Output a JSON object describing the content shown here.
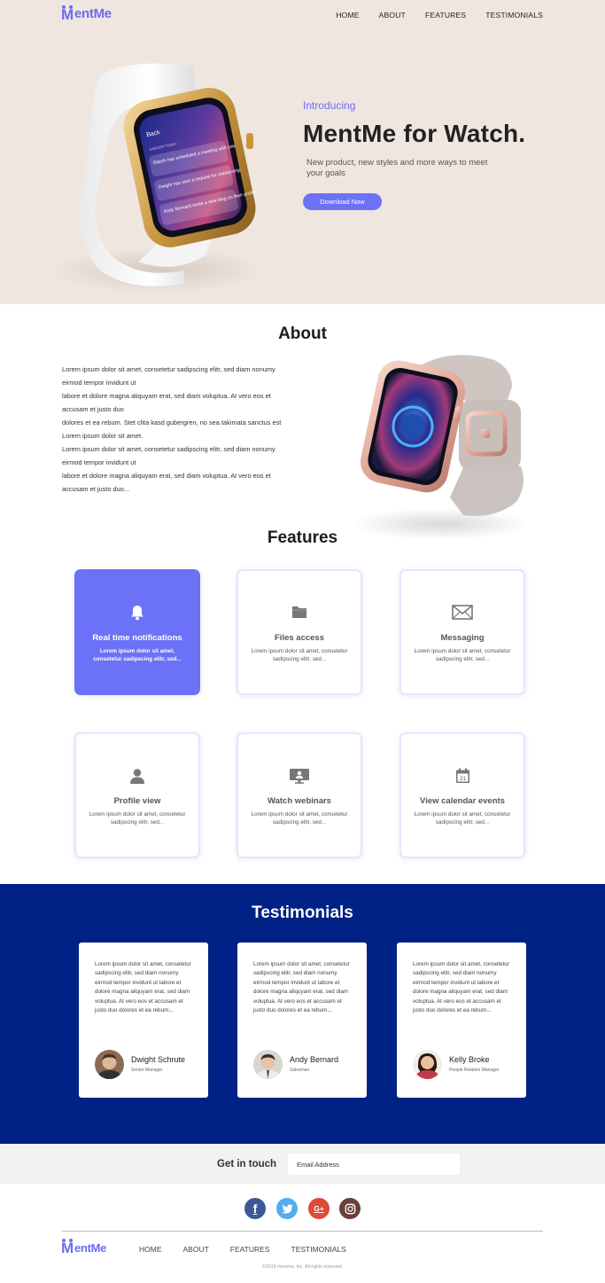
{
  "brand": {
    "name": "MentMe",
    "color": "#6b6bf0"
  },
  "nav": {
    "home": "HOME",
    "about": "ABOUT",
    "features": "FEATURES",
    "testimonials": "TESTIMONIALS"
  },
  "hero": {
    "intro": "Introducing",
    "title": "MentMe for Watch.",
    "subtitle": "New product, new styles and more ways to meet your goals",
    "download": "Download Now",
    "watch_screen": {
      "back": "Back",
      "header": "EARLIER TODAY",
      "items": [
        "Ritesh has scheduled a meeting with you",
        "Dwight has sent a request for mentorship",
        "Andy Bernard wrote a new blog on their profile"
      ]
    }
  },
  "about": {
    "title": "About",
    "lines": [
      "Lorem ipsum dolor sit amet, consetetur sadipscing  elitr, sed diam nonumy eirmod tempor invidunt ut",
      "labore et dolore magna aliquyam erat, sed diam  voluptua. At vero eos et accusam et justo duo",
      "dolores et ea rebum. Stet clita kasd gubergren, no  sea takimata sanctus est Lorem ipsum dolor sit amet.",
      "Lorem ipsum dolor sit amet, consetetur sadipscing  elitr, sed diam nonumy eirmod tempor invidunt ut",
      "labore et dolore magna aliquyam erat, sed diam  voluptua. At vero eos et accusam et justo duo..."
    ]
  },
  "features": {
    "title": "Features",
    "items": [
      {
        "icon": "bell-icon",
        "title": "Real time notifications",
        "desc": "Lorem ipsum dolor sit amet, consetetur sadipscing elitr, sed..."
      },
      {
        "icon": "folder-icon",
        "title": "Files access",
        "desc": "Lorem ipsum dolor sit amet, consetetur sadipscing elitr, sed..."
      },
      {
        "icon": "envelope-icon",
        "title": "Messaging",
        "desc": "Lorem ipsum dolor sit amet, consetetur sadipscing elitr, sed..."
      },
      {
        "icon": "user-icon",
        "title": "Profile view",
        "desc": "Lorem ipsum dolor sit amet, consetetur sadipscing elitr, sed..."
      },
      {
        "icon": "presentation-icon",
        "title": "Watch webinars",
        "desc": "Lorem ipsum dolor sit amet, consetetur sadipscing elitr, sed..."
      },
      {
        "icon": "calendar-icon",
        "title": "View calendar events",
        "desc": "Lorem ipsum dolor sit amet, consetetur sadipscing elitr, sed...",
        "calendar_day": "21"
      }
    ]
  },
  "testimonials": {
    "title": "Testimonials",
    "items": [
      {
        "quote": "Lorem ipsum dolor sit amet, consetetur sadipscing elitr, sed diam nonumy eirmod tempor invidunt ut labore et dolore magna aliquyam erat, sed diam voluptua. At vero eos et accusam et justo duo dolores et ea rebum...",
        "name": "Dwight Schrute",
        "role": "Senior Manager"
      },
      {
        "quote": "Lorem ipsum dolor sit amet, consetetur sadipscing elitr, sed diam nonumy eirmod tempor invidunt ut labore et dolore magna aliquyam erat, sed diam voluptua. At vero eos et accusam et justo duo dolores et ea rebum...",
        "name": "Andy Bernard",
        "role": "Salesman"
      },
      {
        "quote": "Lorem ipsum dolor sit amet, consetetur sadipscing elitr, sed diam nonumy eirmod tempor invidunt ut labore et dolore magna aliquyam erat, sed diam voluptua. At vero eos et accusam et justo duo dolores et ea rebum...",
        "name": "Kelly Broke",
        "role": "People Relation Manager"
      }
    ]
  },
  "contact": {
    "label": "Get in touch",
    "placeholder": "Email Address"
  },
  "social": {
    "facebook": "f",
    "google": "G+"
  },
  "footer": {
    "copyright": "©2019 mentme, Inc. All rights reserved."
  },
  "colors": {
    "accent": "#6b72f7",
    "hero_bg": "#efe6e0",
    "testimonials_bg": "#002185",
    "contact_bg": "#f2f2f2"
  }
}
